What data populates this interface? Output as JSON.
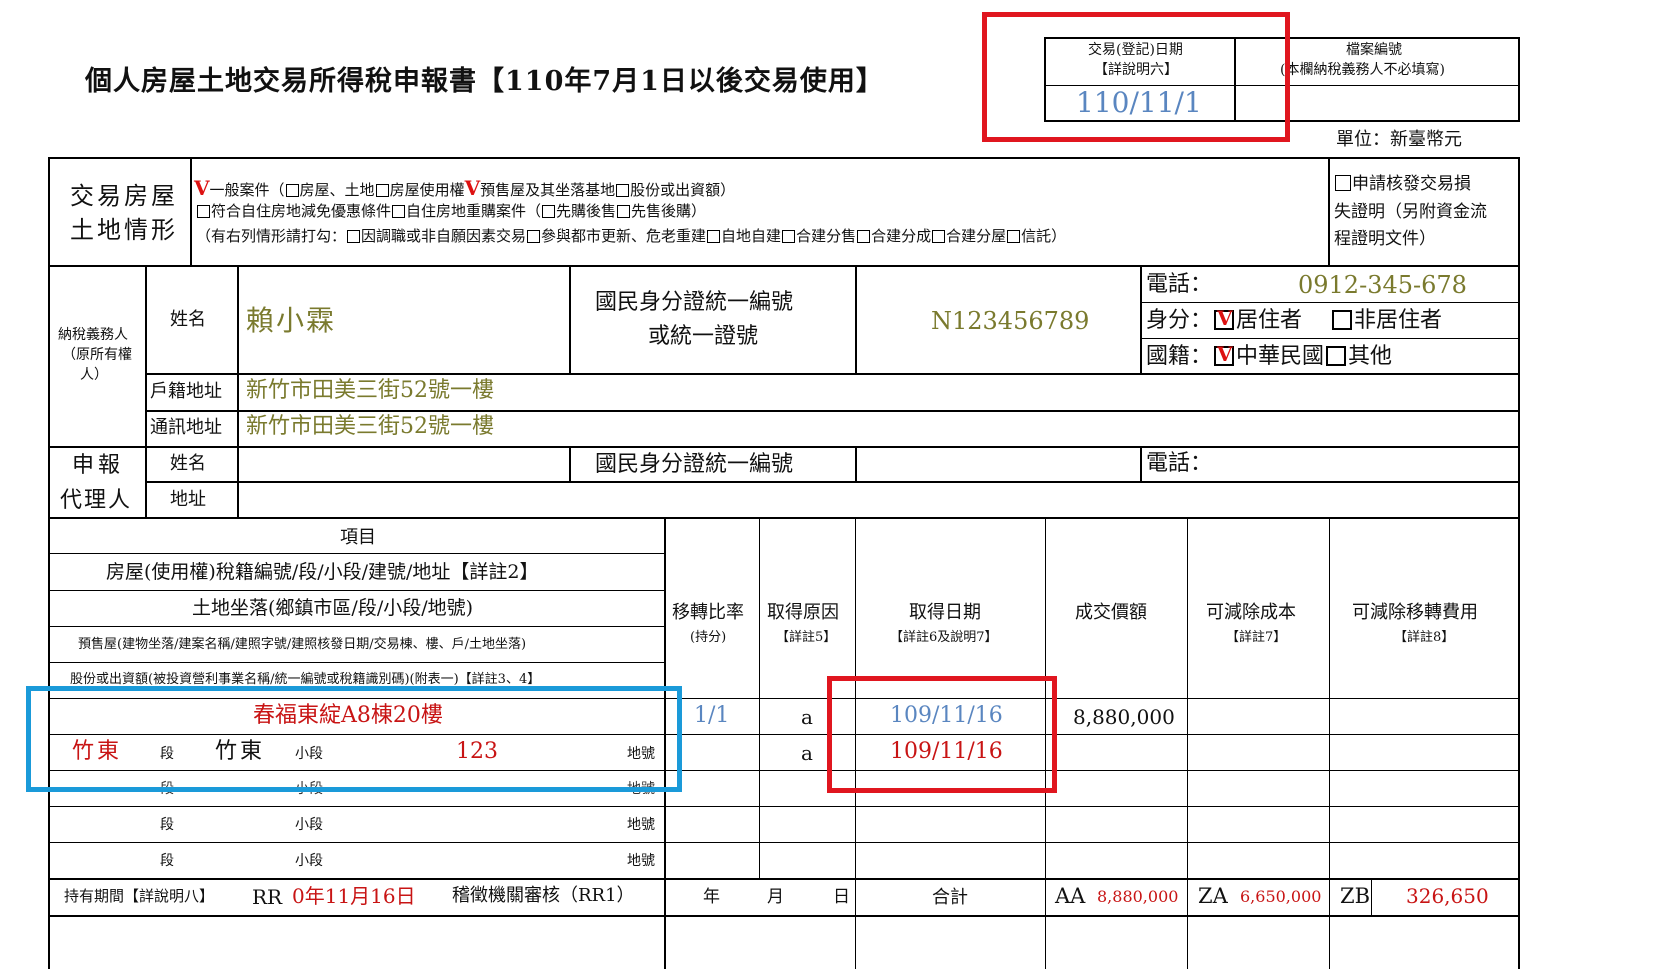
{
  "form": {
    "title": "個人房屋土地交易所得稅申報書【110年7月1日以後交易使用】",
    "unit": "單位：新臺幣元"
  },
  "header_box": {
    "date_label_1": "交易(登記)日期",
    "date_label_2": "【詳說明六】",
    "date_value": "110/11/1",
    "file_label_1": "檔案編號",
    "file_label_2": "(本欄納稅義務人不必填寫)"
  },
  "situation": {
    "label_1": "交易房屋",
    "label_2": "土地情形",
    "row1_general": "一般案件（",
    "row1_items": [
      "房屋、土地",
      "房屋使用權",
      "預售屋及其坐落基地",
      "股份或出資額）"
    ],
    "row2_items": [
      "符合自住房地減免優惠條件",
      "自住房地重購案件（",
      "先購後售",
      "先售後購）"
    ],
    "row3_prefix": "（有右列情形請打勾：",
    "row3_items": [
      "因調職或非自願因素交易",
      "參與都市更新、危老重建",
      "自地自建",
      "合建分售",
      "合建分成",
      "合建分屋",
      "信託）"
    ],
    "apply_1": "申請核發交易損",
    "apply_2": "失證明（另附資金流",
    "apply_3": "程證明文件）",
    "check_mark": "V"
  },
  "taxpayer": {
    "side_label_1": "納稅義務人",
    "side_label_2": "（原所有權",
    "side_label_3": "人）",
    "name_label": "姓名",
    "name_value": "賴小霖",
    "id_label_1": "國民身分證統一編號",
    "id_label_2": "或統一證號",
    "id_value": "N123456789",
    "phone_label": "電話：",
    "phone_value": "0912-345-678",
    "status_label": "身分：",
    "resident": "居住者",
    "nonresident": "非居住者",
    "nation_label": "國籍：",
    "roc": "中華民國",
    "other": "其他",
    "household_label": "戶籍地址",
    "household_value": "新竹市田美三街52號一樓",
    "mail_label": "通訊地址",
    "mail_value": "新竹市田美三街52號一樓"
  },
  "agent": {
    "label_1": "申報",
    "label_2": "代理人",
    "name_label": "姓名",
    "id_label": "國民身分證統一編號",
    "phone_label": "電話：",
    "addr_label": "地址"
  },
  "items": {
    "header": "項目",
    "h_house": "房屋(使用權)稅籍編號/段/小段/建號/地址【詳註2】",
    "h_land": "土地坐落(鄉鎮市區/段/小段/地號)",
    "h_presale": "預售屋(建物坐落/建案名稱/建照字號/建照核發日期/交易棟、樓、戶/土地坐落)",
    "h_share": "股份或出資額(被投資營利事業名稱/統一編號或稅籍識別碼)(附表一)【詳註3、4】",
    "col_ratio_1": "移轉比率",
    "col_ratio_2": "(持分)",
    "col_reason_1": "取得原因",
    "col_reason_2": "【詳註5】",
    "col_date_1": "取得日期",
    "col_date_2": "【詳註6及說明7】",
    "col_price": "成交價額",
    "col_cost_1": "可減除成本",
    "col_cost_2": "【詳註7】",
    "col_fee_1": "可減除移轉費用",
    "col_fee_2": "【詳註8】",
    "seg": "段",
    "subseg": "小段",
    "lotno": "地號",
    "row1_building": "春福東綻A8棟20樓",
    "row1_ratio": "1/1",
    "row1_reason": "a",
    "row1_date": "109/11/16",
    "row1_price": "8,880,000",
    "row2_seg": "竹東",
    "row2_subseg": "竹東",
    "row2_lot": "123",
    "row2_reason": "a",
    "row2_date": "109/11/16"
  },
  "footer": {
    "period_label": "持有期間【詳說明八】",
    "rr": "RR",
    "period_value": "0年11月16日",
    "review": "稽徵機關審核（RR1）",
    "year": "年",
    "month": "月",
    "day": "日",
    "total": "合計",
    "aa": "AA",
    "aa_value": "8,880,000",
    "za": "ZA",
    "za_value": "6,650,000",
    "zb": "ZB",
    "zb_value": "326,650"
  }
}
